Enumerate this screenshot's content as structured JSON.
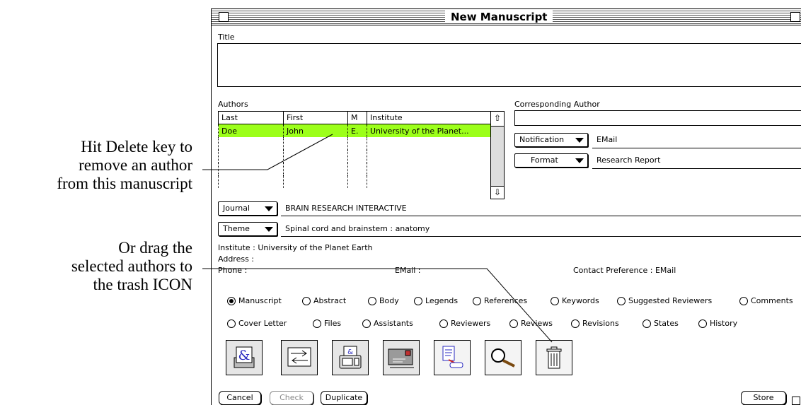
{
  "callouts": {
    "delete_lines": [
      "Hit Delete key to",
      "remove an author",
      "from this manuscript"
    ],
    "drag_lines": [
      "Or drag the",
      "selected authors to",
      "the trash ICON"
    ]
  },
  "window": {
    "title": "New Manuscript",
    "title_label": "Title",
    "title_value": ""
  },
  "authors": {
    "label": "Authors",
    "columns": [
      "Last",
      "First",
      "M",
      "Institute"
    ],
    "rows": [
      {
        "last": "Doe",
        "first": "John",
        "m": "E.",
        "institute": "University of the Planet...",
        "selected": true
      }
    ]
  },
  "corresponding": {
    "label": "Corresponding Author",
    "value": "",
    "notification_label": "Notification",
    "notification_value": "EMail",
    "format_label": "Format",
    "format_value": "Research Report"
  },
  "journal": {
    "label": "Journal",
    "value": "BRAIN RESEARCH INTERACTIVE"
  },
  "theme": {
    "label": "Theme",
    "value": "Spinal cord and brainstem : anatomy"
  },
  "info": {
    "institute": "Institute : University of the Planet Earth",
    "address": "Address :",
    "phone": "Phone :",
    "email": "EMail :",
    "contact": "Contact Preference : EMail"
  },
  "radios_row1": [
    "Manuscript",
    "Abstract",
    "Body",
    "Legends",
    "References",
    "Keywords",
    "Suggested Reviewers",
    "Comments"
  ],
  "radios_row2": [
    "Cover Letter",
    "Files",
    "Assistants",
    "Reviewers",
    "Reviews",
    "Revisions",
    "States",
    "History"
  ],
  "selected_radio": "Manuscript",
  "toolbar_icons": [
    "author-card-icon",
    "transfer-icon",
    "fax-icon",
    "envelope-icon",
    "document-arrow-icon",
    "magnifier-icon",
    "trash-icon"
  ],
  "buttons": {
    "cancel": "Cancel",
    "check": "Check",
    "duplicate": "Duplicate",
    "store": "Store"
  },
  "colors": {
    "selection": "#9cff1a"
  }
}
